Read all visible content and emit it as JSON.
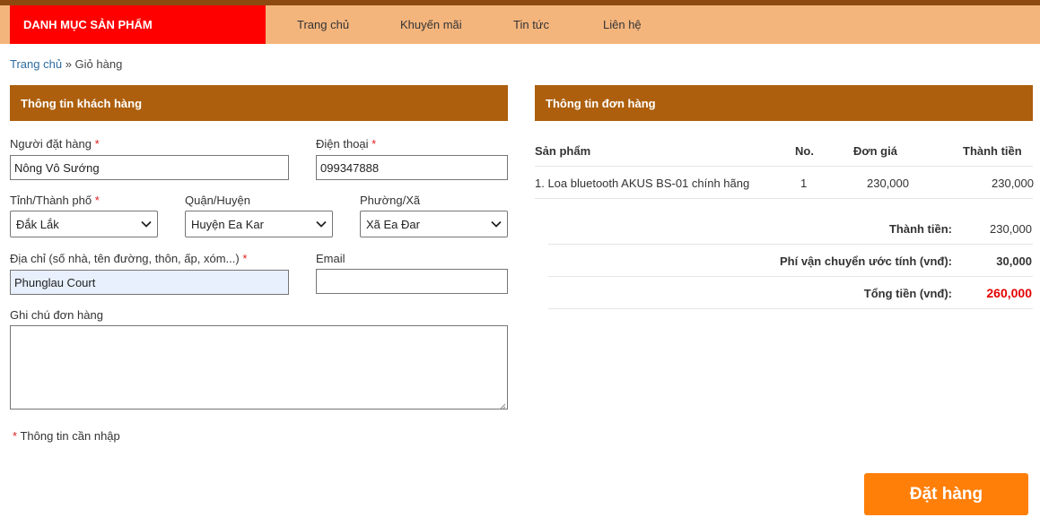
{
  "nav": {
    "category_button": "DANH MỤC SẢN PHẨM",
    "links": [
      "Trang chủ",
      "Khuyến mãi",
      "Tin tức",
      "Liên hệ"
    ]
  },
  "breadcrumb": {
    "home": "Trang chủ",
    "separator": "»",
    "current": "Giỏ hàng"
  },
  "customer": {
    "title": "Thông tin khách hàng",
    "required_mark": "*",
    "name_label": "Người đặt hàng",
    "name_value": "Nông Vô Sướng",
    "phone_label": "Điện thoại",
    "phone_value": "099347888",
    "province_label": "Tỉnh/Thành phố",
    "province_value": "Đắk Lắk",
    "district_label": "Quận/Huyện",
    "district_value": "Huyện Ea Kar",
    "ward_label": "Phường/Xã",
    "ward_value": "Xã Ea Đar",
    "address_label": "Địa chỉ (số nhà, tên đường, thôn, ấp, xóm...)",
    "address_value": "Phunglau Court",
    "email_label": "Email",
    "email_value": "",
    "note_label": "Ghi chú đơn hàng",
    "note_value": "",
    "required_note": "Thông tin cần nhập"
  },
  "order": {
    "title": "Thông tin đơn hàng",
    "columns": [
      "Sản phẩm",
      "No.",
      "Đơn giá",
      "Thành tiền"
    ],
    "items": [
      {
        "product": "1. Loa bluetooth AKUS BS-01 chính hãng",
        "qty": "1",
        "unit_price": "230,000",
        "subtotal": "230,000"
      }
    ],
    "summary": {
      "subtotal_label": "Thành tiền:",
      "subtotal_value": "230,000",
      "shipping_label": "Phí vận chuyển ước tính (vnđ):",
      "shipping_value": "30,000",
      "total_label": "Tổng tiền (vnđ):",
      "total_value": "260,000"
    }
  },
  "submit_label": "Đặt hàng",
  "colors": {
    "topbar": "#8c4a10",
    "navbar": "#f4b57d",
    "category_button": "#ff0000",
    "panel_header": "#ad5f0d",
    "order_button": "#ff7f09",
    "total_red": "#e40000",
    "link_blue": "#2d6ca2"
  },
  "icons": {
    "select_arrow": "chevron-down-icon",
    "resize": "resize-grip-icon"
  }
}
